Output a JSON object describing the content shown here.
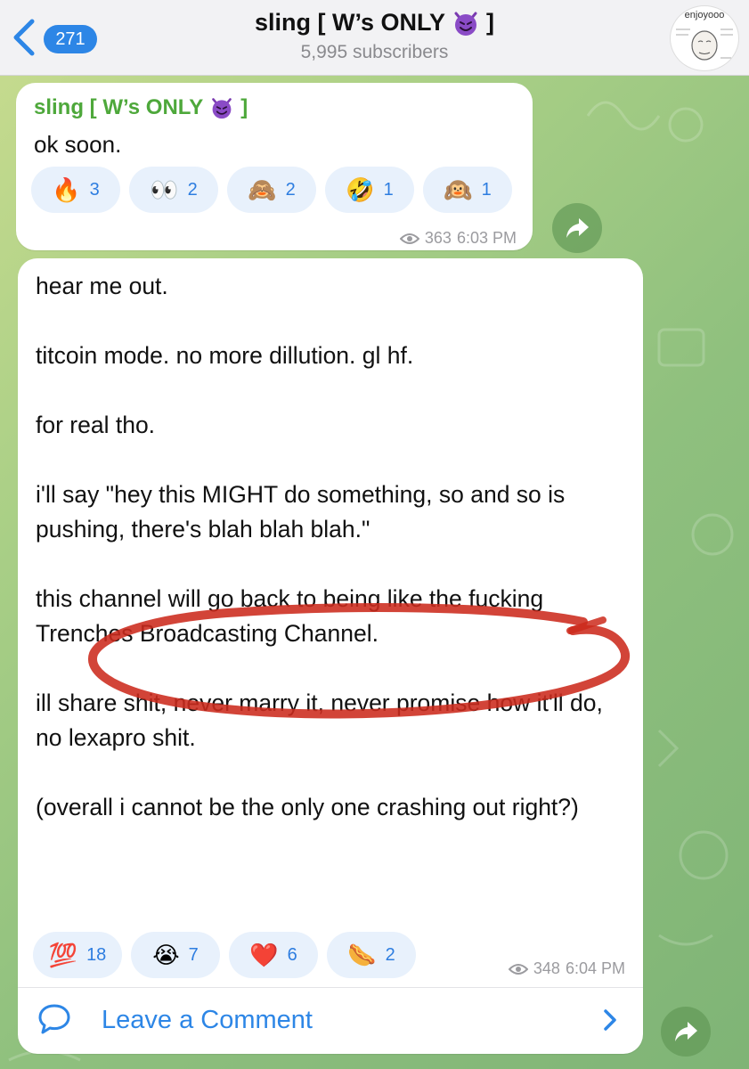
{
  "header": {
    "back_count": "271",
    "title_prefix": "sling [ W’s ONLY",
    "title_suffix": "]",
    "subscribers": "5,995 subscribers",
    "avatar_text": "enjoyooo"
  },
  "message1": {
    "sender_prefix": "sling [ W’s ONLY",
    "sender_suffix": "]",
    "text": "ok soon.",
    "reactions": [
      {
        "emoji": "🔥",
        "count": "3"
      },
      {
        "emoji": "👀",
        "count": "2"
      },
      {
        "emoji": "🙈",
        "count": "2"
      },
      {
        "emoji": "🤣",
        "count": "1"
      },
      {
        "emoji": "🙉",
        "count": "1"
      }
    ],
    "views": "363",
    "time": "6:03 PM"
  },
  "message2": {
    "paragraphs": [
      "hear me out.",
      "titcoin mode. no more dillution. gl hf.",
      "for real tho.",
      "i'll say \"hey this MIGHT do something, so and so is pushing, there's blah blah blah.\"",
      "this channel will go back to being like the fucking Trenches Broadcasting Channel.",
      "ill share shit, never marry it, never promise how it'll do, no lexapro shit.",
      "(overall i cannot be the only one crashing out right?)"
    ],
    "reactions": [
      {
        "emoji": "💯",
        "count": "18"
      },
      {
        "emoji": "😭",
        "count": "7"
      },
      {
        "emoji": "❤️",
        "count": "6"
      },
      {
        "emoji": "🌭",
        "count": "2"
      }
    ],
    "views": "348",
    "time": "6:04 PM",
    "comment_label": "Leave a Comment"
  },
  "colors": {
    "accent": "#2d86e6",
    "sender": "#4ea83b",
    "reaction_bg": "#e8f1fc",
    "scribble": "#cc2a1c"
  }
}
